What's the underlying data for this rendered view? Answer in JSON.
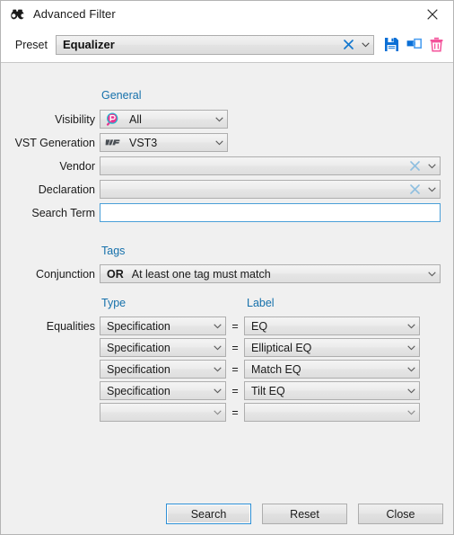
{
  "window": {
    "title": "Advanced Filter",
    "title_icon": "binoculars-icon",
    "close_icon": "close-icon"
  },
  "preset": {
    "label": "Preset",
    "value": "Equalizer",
    "clear_icon": "clear-x-icon",
    "dropdown_icon": "chevron-down-icon",
    "tools": [
      {
        "name": "save-preset-button",
        "icon": "floppy-disk-icon",
        "color": "#0a6fd6"
      },
      {
        "name": "duplicate-preset-button",
        "icon": "duplicate-icon",
        "color": "#2684e8"
      },
      {
        "name": "delete-preset-button",
        "icon": "trash-icon",
        "color": "#f4539b"
      }
    ]
  },
  "general": {
    "section_title": "General",
    "visibility": {
      "label": "Visibility",
      "value": "All",
      "icon": "visibility-plugin-icon"
    },
    "vst_generation": {
      "label": "VST Generation",
      "value": "VST3",
      "icon": "vst-logo-icon"
    },
    "vendor": {
      "label": "Vendor",
      "value": "",
      "placeholder": ""
    },
    "declaration": {
      "label": "Declaration",
      "value": "",
      "placeholder": ""
    },
    "search_term": {
      "label": "Search Term",
      "value": "",
      "placeholder": ""
    }
  },
  "tags": {
    "section_title": "Tags",
    "conjunction": {
      "label": "Conjunction",
      "operator": "OR",
      "description": "At least one tag must match"
    },
    "column_headers": {
      "type": "Type",
      "label": "Label"
    },
    "equalities_label": "Equalities",
    "operator_symbol": "=",
    "equalities": [
      {
        "type": "Specification",
        "label": "EQ"
      },
      {
        "type": "Specification",
        "label": "Elliptical EQ"
      },
      {
        "type": "Specification",
        "label": "Match EQ"
      },
      {
        "type": "Specification",
        "label": "Tilt EQ"
      },
      {
        "type": "",
        "label": ""
      }
    ]
  },
  "footer": {
    "search": "Search",
    "reset": "Reset",
    "close": "Close"
  },
  "colors": {
    "section_heading": "#1570ab",
    "focus_border": "#4a9fd8",
    "accent_pink": "#f4539b",
    "accent_blue": "#0a6fd6"
  }
}
